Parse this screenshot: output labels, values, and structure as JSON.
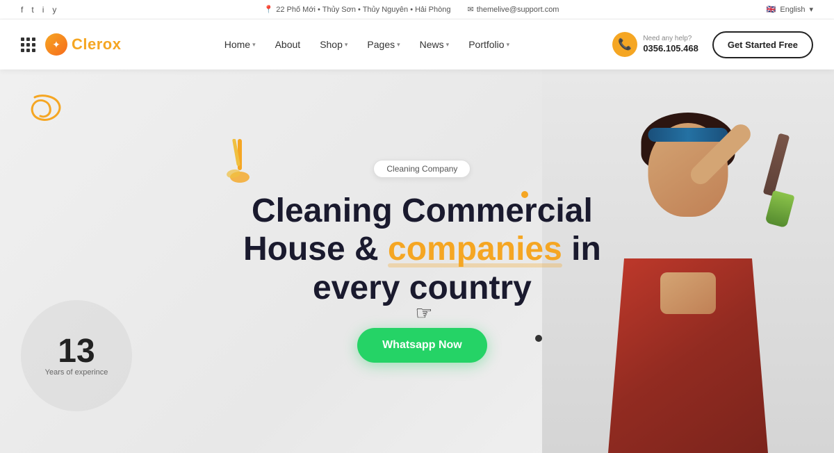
{
  "topbar": {
    "social": {
      "facebook": "f",
      "twitter": "t",
      "instagram": "i",
      "youtube": "y"
    },
    "address": "22 Phố Mới • Thủy Sơn • Thủy Nguyên • Hải Phòng",
    "email": "themelive@support.com",
    "language": "English"
  },
  "navbar": {
    "logo_text": "Clerox",
    "menu": [
      {
        "label": "Home",
        "has_dropdown": true
      },
      {
        "label": "About",
        "has_dropdown": false
      },
      {
        "label": "Shop",
        "has_dropdown": true
      },
      {
        "label": "Pages",
        "has_dropdown": true
      },
      {
        "label": "News",
        "has_dropdown": true
      },
      {
        "label": "Portfolio",
        "has_dropdown": true
      }
    ],
    "phone": {
      "need_help": "Need any help?",
      "number": "0356.105.468"
    },
    "cta_label": "Get Started Free"
  },
  "hero": {
    "badge": "Cleaning Company",
    "title_line1": "Cleaning Commercial",
    "title_line2_before": "House & ",
    "title_highlight": "companies",
    "title_line2_after": " in",
    "title_line3": "every country",
    "whatsapp_button": "Whatsapp Now",
    "years_number": "13",
    "years_label": "Years of experince"
  },
  "colors": {
    "accent_yellow": "#f5a623",
    "accent_green": "#25d366",
    "teal_splash": "#1a7a5e",
    "dark": "#1a1a2e",
    "white": "#ffffff"
  }
}
